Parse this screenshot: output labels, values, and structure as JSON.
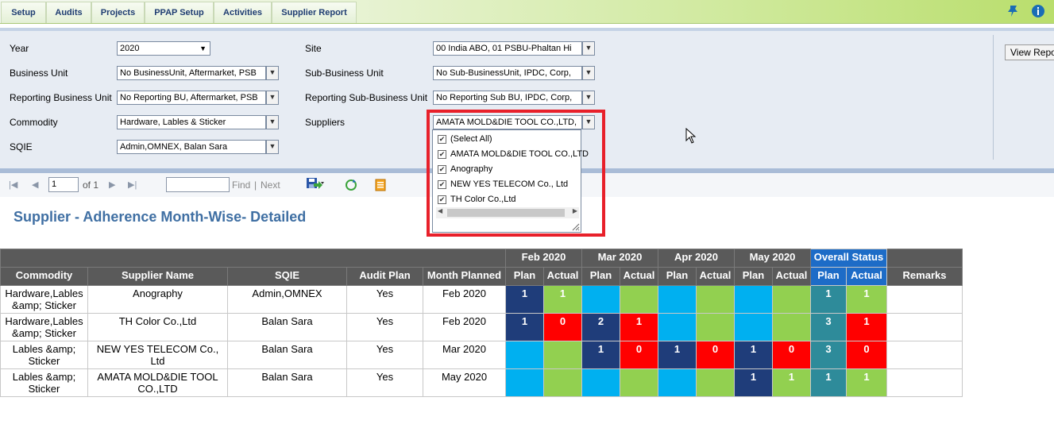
{
  "nav": {
    "tabs": [
      "Setup",
      "Audits",
      "Projects",
      "PPAP Setup",
      "Activities",
      "Supplier Report"
    ],
    "pin_icon": "pin-icon",
    "info_icon": "info-icon"
  },
  "params": {
    "year": {
      "label": "Year",
      "value": "2020"
    },
    "business_unit": {
      "label": "Business Unit",
      "value": "No BusinessUnit, Aftermarket, PSB"
    },
    "reporting_bu": {
      "label": "Reporting Business Unit",
      "value": "No Reporting BU, Aftermarket, PSB"
    },
    "commodity": {
      "label": "Commodity",
      "value": "Hardware, Lables & Sticker"
    },
    "sqie": {
      "label": "SQIE",
      "value": "Admin,OMNEX, Balan Sara"
    },
    "site": {
      "label": "Site",
      "value": "00 India ABO, 01 PSBU-Phaltan Hi"
    },
    "sub_bu": {
      "label": "Sub-Business Unit",
      "value": "No Sub-BusinessUnit, IPDC, Corp,"
    },
    "reporting_sub_bu": {
      "label": "Reporting Sub-Business Unit",
      "value": "No Reporting Sub BU, IPDC, Corp,"
    },
    "suppliers": {
      "label": "Suppliers",
      "value": "AMATA MOLD&DIE TOOL CO.,LTD,"
    },
    "view_report": "View Report"
  },
  "suppliers_dropdown": {
    "items": [
      "(Select All)",
      "AMATA MOLD&DIE TOOL CO.,LTD",
      "Anography",
      "NEW YES TELECOM Co., Ltd",
      "TH Color Co.,Ltd"
    ]
  },
  "toolbar": {
    "page": "1",
    "of": "of 1",
    "find": "Find",
    "sep": "|",
    "next": "Next",
    "find_value": ""
  },
  "report": {
    "title": "Supplier - Adherence Month-Wise- Detailed",
    "months": [
      "Feb 2020",
      "Mar 2020",
      "Apr 2020",
      "May 2020"
    ],
    "overall": "Overall Status",
    "headers": [
      "Commodity",
      "Supplier Name",
      "SQIE",
      "Audit Plan",
      "Month Planned"
    ],
    "plan": "Plan",
    "actual": "Actual",
    "remarks": "Remarks",
    "rows": [
      {
        "commodity": "Hardware,Lables &amp; Sticker",
        "supplier": "Anography",
        "sqie": "Admin,OMNEX",
        "audit_plan": "Yes",
        "month": "Feb 2020",
        "cells": [
          {
            "v": "1",
            "c": "c-dark"
          },
          {
            "v": "1",
            "c": "c-green"
          },
          {
            "v": "",
            "c": "c-cyan"
          },
          {
            "v": "",
            "c": "c-green"
          },
          {
            "v": "",
            "c": "c-cyan"
          },
          {
            "v": "",
            "c": "c-green"
          },
          {
            "v": "",
            "c": "c-cyan"
          },
          {
            "v": "",
            "c": "c-green"
          },
          {
            "v": "1",
            "c": "c-teal"
          },
          {
            "v": "1",
            "c": "c-green"
          }
        ]
      },
      {
        "commodity": "Hardware,Lables &amp; Sticker",
        "supplier": "TH Color Co.,Ltd",
        "sqie": "Balan Sara",
        "audit_plan": "Yes",
        "month": "Feb 2020",
        "cells": [
          {
            "v": "1",
            "c": "c-dark"
          },
          {
            "v": "0",
            "c": "c-red"
          },
          {
            "v": "2",
            "c": "c-dark"
          },
          {
            "v": "1",
            "c": "c-red"
          },
          {
            "v": "",
            "c": "c-cyan"
          },
          {
            "v": "",
            "c": "c-green"
          },
          {
            "v": "",
            "c": "c-cyan"
          },
          {
            "v": "",
            "c": "c-green"
          },
          {
            "v": "3",
            "c": "c-teal"
          },
          {
            "v": "1",
            "c": "c-red"
          }
        ]
      },
      {
        "commodity": "Lables &amp; Sticker",
        "supplier": "NEW YES TELECOM Co., Ltd",
        "sqie": "Balan Sara",
        "audit_plan": "Yes",
        "month": "Mar 2020",
        "cells": [
          {
            "v": "",
            "c": "c-cyan"
          },
          {
            "v": "",
            "c": "c-green"
          },
          {
            "v": "1",
            "c": "c-dark"
          },
          {
            "v": "0",
            "c": "c-red"
          },
          {
            "v": "1",
            "c": "c-dark"
          },
          {
            "v": "0",
            "c": "c-red"
          },
          {
            "v": "1",
            "c": "c-dark"
          },
          {
            "v": "0",
            "c": "c-red"
          },
          {
            "v": "3",
            "c": "c-teal"
          },
          {
            "v": "0",
            "c": "c-red"
          }
        ]
      },
      {
        "commodity": "Lables &amp; Sticker",
        "supplier": "AMATA MOLD&DIE TOOL CO.,LTD",
        "sqie": "Balan Sara",
        "audit_plan": "Yes",
        "month": "May 2020",
        "cells": [
          {
            "v": "",
            "c": "c-cyan"
          },
          {
            "v": "",
            "c": "c-green"
          },
          {
            "v": "",
            "c": "c-cyan"
          },
          {
            "v": "",
            "c": "c-green"
          },
          {
            "v": "",
            "c": "c-cyan"
          },
          {
            "v": "",
            "c": "c-green"
          },
          {
            "v": "1",
            "c": "c-dark"
          },
          {
            "v": "1",
            "c": "c-green"
          },
          {
            "v": "1",
            "c": "c-teal"
          },
          {
            "v": "1",
            "c": "c-green"
          }
        ]
      }
    ]
  }
}
